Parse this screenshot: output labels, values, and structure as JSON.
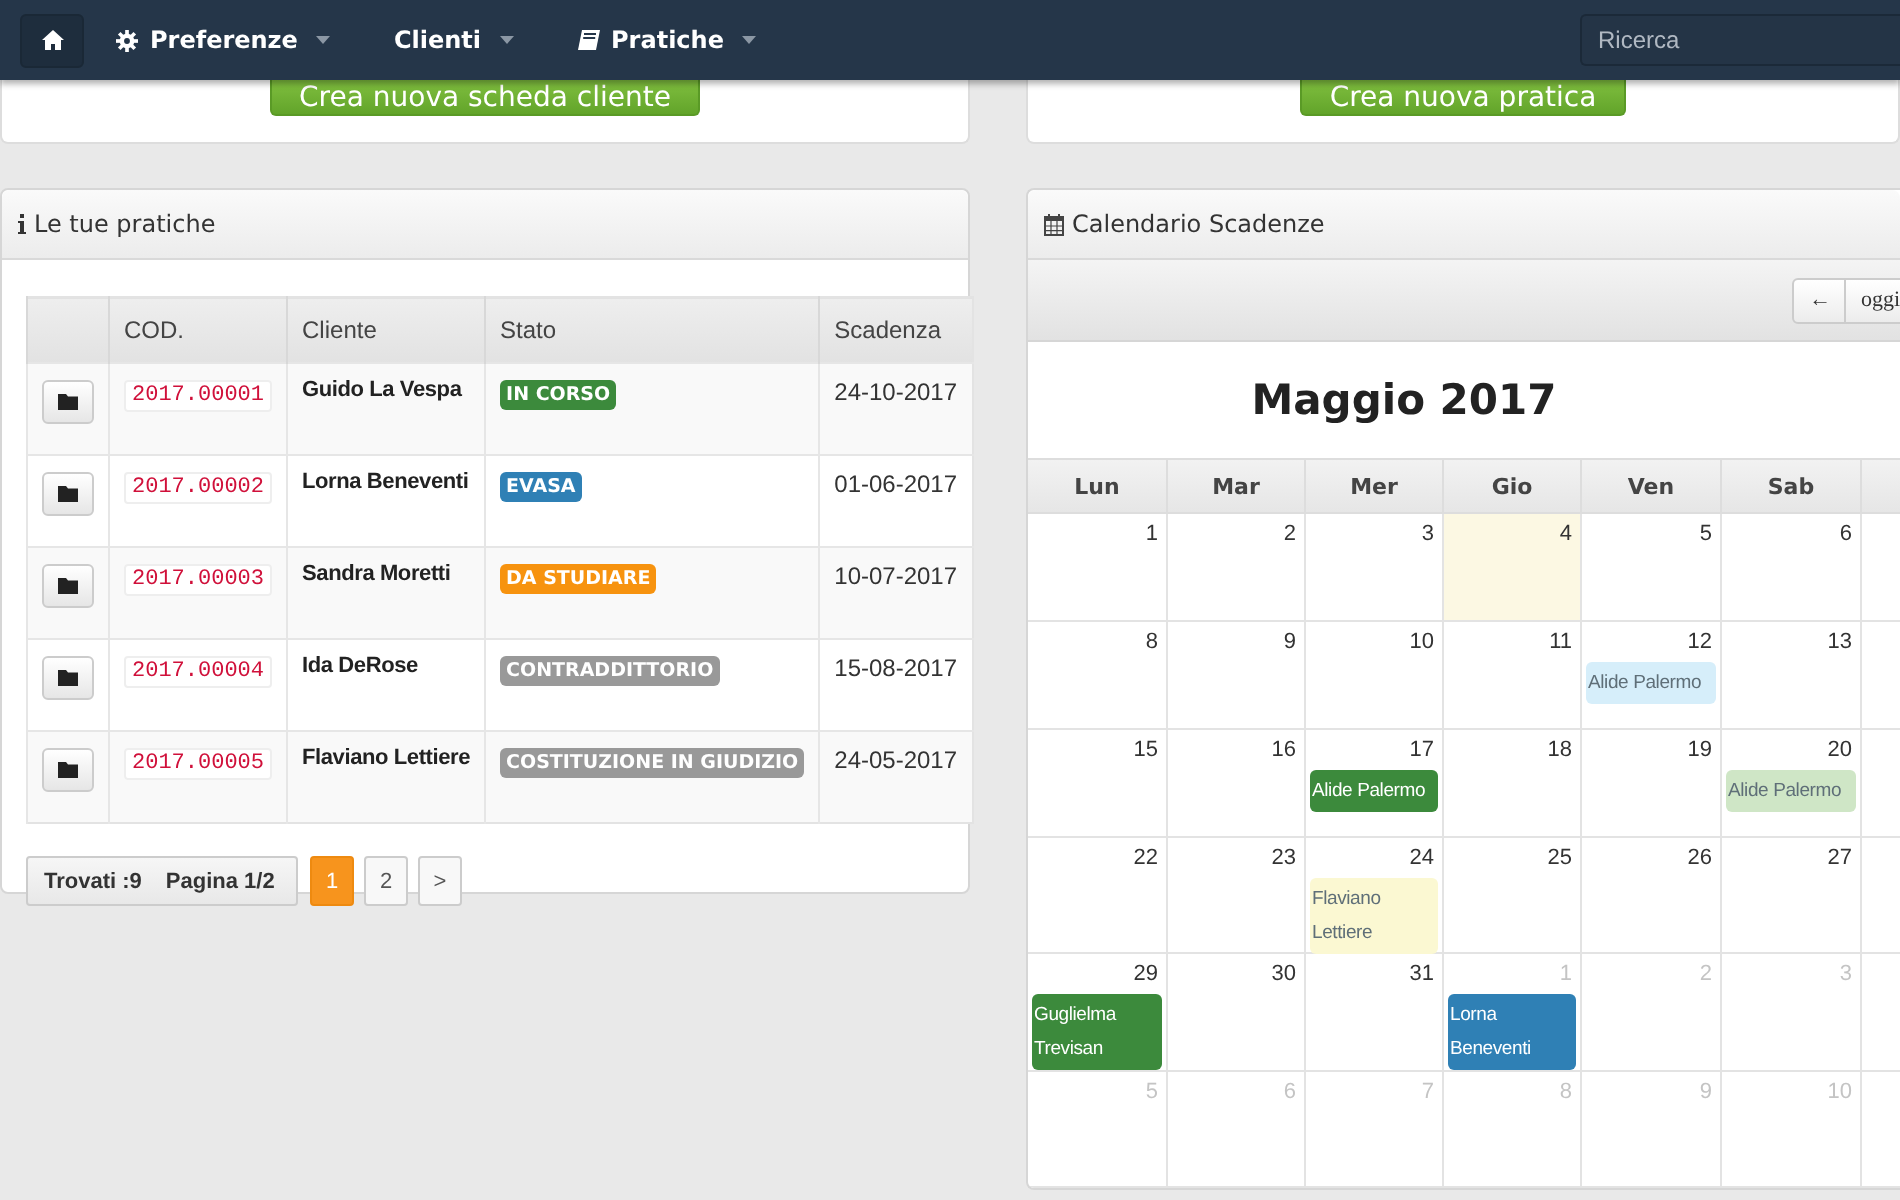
{
  "navbar": {
    "items": [
      {
        "label": "Preferenze",
        "kind": "gear"
      },
      {
        "label": "Clienti",
        "kind": "plain"
      },
      {
        "label": "Pratiche",
        "kind": "book"
      }
    ],
    "search": {
      "placeholder": "Ricerca"
    }
  },
  "top_cards": [
    {
      "button": "Crea nuova scheda cliente"
    },
    {
      "button": "Crea nuova pratica"
    }
  ],
  "pratiche": {
    "title": "Le tue pratiche",
    "columns": [
      "COD.",
      "Cliente",
      "Stato",
      "Scadenza"
    ],
    "rows": [
      {
        "code": "2017.00001",
        "client": "Guido La Vespa",
        "status": {
          "label": "IN CORSO",
          "color": "#3c8a3c"
        },
        "deadline": "24-10-2017"
      },
      {
        "code": "2017.00002",
        "client": "Lorna Beneventi",
        "status": {
          "label": "EVASA",
          "color": "#2f80b5"
        },
        "deadline": "01-06-2017"
      },
      {
        "code": "2017.00003",
        "client": "Sandra Moretti",
        "status": {
          "label": "DA STUDIARE",
          "color": "#f7930f"
        },
        "deadline": "10-07-2017"
      },
      {
        "code": "2017.00004",
        "client": "Ida DeRose",
        "status": {
          "label": "CONTRADDITTORIO",
          "color": "#999999"
        },
        "deadline": "15-08-2017"
      },
      {
        "code": "2017.00005",
        "client": "Flaviano Lettiere",
        "status": {
          "label": "COSTITUZIONE IN GIUDIZIO",
          "color": "#999999"
        },
        "deadline": "24-05-2017"
      }
    ],
    "pagination": {
      "found": "Trovati :9",
      "page_info": "Pagina 1/2",
      "pages": [
        {
          "label": "1",
          "selected": true
        },
        {
          "label": "2",
          "selected": false
        }
      ],
      "next": ">"
    }
  },
  "calendar": {
    "title": "Calendario Scadenze",
    "toolbar": {
      "prev": "←",
      "today": "oggi"
    },
    "month": "Maggio 2017",
    "weekdays": [
      "Lun",
      "Mar",
      "Mer",
      "Gio",
      "Ven",
      "Sab"
    ],
    "weeks": [
      [
        {
          "day": "1",
          "other_month": false,
          "today": false
        },
        {
          "day": "2",
          "other_month": false,
          "today": false
        },
        {
          "day": "3",
          "other_month": false,
          "today": false
        },
        {
          "day": "4",
          "other_month": false,
          "today": true
        },
        {
          "day": "5",
          "other_month": false,
          "today": false
        },
        {
          "day": "6",
          "other_month": false,
          "today": false
        }
      ],
      [
        {
          "day": "8",
          "other_month": false,
          "today": false
        },
        {
          "day": "9",
          "other_month": false,
          "today": false
        },
        {
          "day": "10",
          "other_month": false,
          "today": false
        },
        {
          "day": "11",
          "other_month": false,
          "today": false
        },
        {
          "day": "12",
          "other_month": false,
          "today": false,
          "events": [
            {
              "label": "Alide Palermo",
              "color": "#d6eefa"
            }
          ]
        },
        {
          "day": "13",
          "other_month": false,
          "today": false
        }
      ],
      [
        {
          "day": "15",
          "other_month": false,
          "today": false
        },
        {
          "day": "16",
          "other_month": false,
          "today": false
        },
        {
          "day": "17",
          "other_month": false,
          "today": false,
          "events": [
            {
              "label": "Alide Palermo",
              "color": "#3c8a3c"
            }
          ]
        },
        {
          "day": "18",
          "other_month": false,
          "today": false
        },
        {
          "day": "19",
          "other_month": false,
          "today": false
        },
        {
          "day": "20",
          "other_month": false,
          "today": false,
          "events": [
            {
              "label": "Alide Palermo",
              "color": "#cfe6c6"
            }
          ]
        }
      ],
      [
        {
          "day": "22",
          "other_month": false,
          "today": false
        },
        {
          "day": "23",
          "other_month": false,
          "today": false
        },
        {
          "day": "24",
          "other_month": false,
          "today": false,
          "events": [
            {
              "label": "Flaviano Lettiere",
              "color": "#fbf8d2"
            }
          ]
        },
        {
          "day": "25",
          "other_month": false,
          "today": false
        },
        {
          "day": "26",
          "other_month": false,
          "today": false
        },
        {
          "day": "27",
          "other_month": false,
          "today": false
        }
      ],
      [
        {
          "day": "29",
          "other_month": false,
          "today": false,
          "events": [
            {
              "label": "Guglielma Trevisan",
              "color": "#3c8a3c"
            }
          ]
        },
        {
          "day": "30",
          "other_month": false,
          "today": false
        },
        {
          "day": "31",
          "other_month": false,
          "today": false
        },
        {
          "day": "1",
          "other_month": true,
          "today": false,
          "events": [
            {
              "label": "Lorna Beneventi",
              "color": "#2f80b5"
            }
          ]
        },
        {
          "day": "2",
          "other_month": true,
          "today": false
        },
        {
          "day": "3",
          "other_month": true,
          "today": false
        }
      ],
      [
        {
          "day": "5",
          "other_month": true,
          "today": false
        },
        {
          "day": "6",
          "other_month": true,
          "today": false
        },
        {
          "day": "7",
          "other_month": true,
          "today": false
        },
        {
          "day": "8",
          "other_month": true,
          "today": false
        },
        {
          "day": "9",
          "other_month": true,
          "today": false
        },
        {
          "day": "10",
          "other_month": true,
          "today": false
        }
      ]
    ]
  }
}
